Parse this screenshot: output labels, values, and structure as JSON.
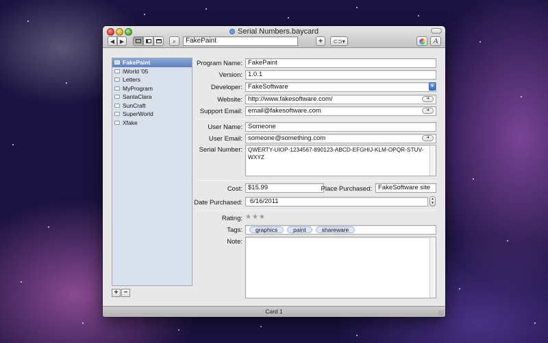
{
  "window": {
    "title": "Serial Numbers.baycard",
    "status_text": "Card 1"
  },
  "toolbar": {
    "back_icon": "chevron-left-icon",
    "forward_icon": "chevron-right-icon",
    "search_value": "FakePaint",
    "add_label": "+"
  },
  "sidebar": {
    "items": [
      {
        "label": "FakePaint"
      },
      {
        "label": "iWorld '05"
      },
      {
        "label": "Letters"
      },
      {
        "label": "MyProgram"
      },
      {
        "label": "SantaClara"
      },
      {
        "label": "SunCraft"
      },
      {
        "label": "SuperWorld"
      },
      {
        "label": "Xfake"
      }
    ],
    "add_label": "+",
    "remove_label": "−"
  },
  "form": {
    "program_name": {
      "label": "Program Name:",
      "value": "FakePaint"
    },
    "version": {
      "label": "Version:",
      "value": "1.0.1"
    },
    "developer": {
      "label": "Developer:",
      "value": "FakeSoftware"
    },
    "website": {
      "label": "Website:",
      "value": "http://www.fakesoftware.com/"
    },
    "support_email": {
      "label": "Support Email:",
      "value": "email@fakesoftware.com"
    },
    "user_name": {
      "label": "User Name:",
      "value": "Someone"
    },
    "user_email": {
      "label": "User Email:",
      "value": "someone@something.com"
    },
    "serial_number": {
      "label": "Serial Number:",
      "value": "QWERTY-UIOP-1234567-890123-ABCD-EFGHIJ-KLM-OPQR-STUV-WXYZ"
    },
    "cost": {
      "label": "Cost:",
      "value": "$15.99"
    },
    "place_purchased": {
      "label": "Place Purchased:",
      "value": "FakeSoftware site"
    },
    "date_purchased": {
      "label": "Date Purchased:",
      "value": "6/16/2011"
    },
    "rating": {
      "label": "Rating:",
      "stars": "★★★",
      "value": 0
    },
    "tags": {
      "label": "Tags:",
      "items": [
        "graphics",
        "paint",
        "shareware"
      ]
    },
    "note": {
      "label": "Note:",
      "value": ""
    }
  }
}
